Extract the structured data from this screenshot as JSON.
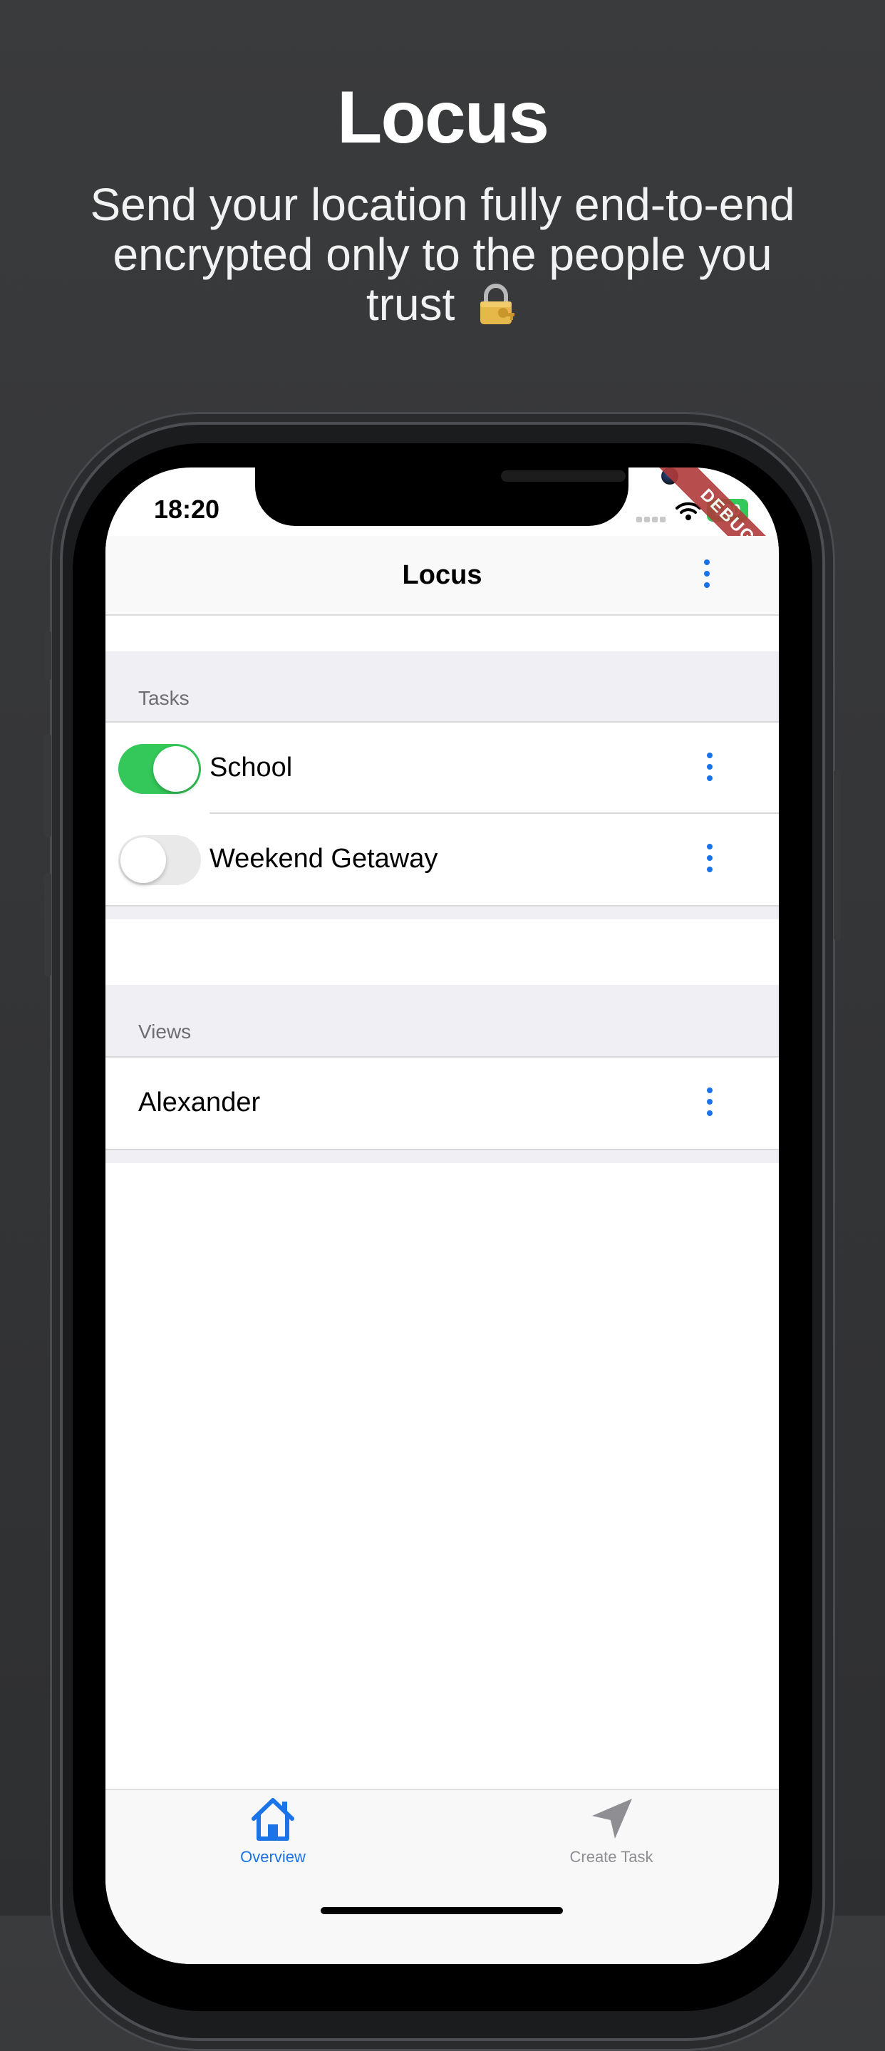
{
  "hero": {
    "title": "Locus",
    "subtitle": "Send your location fully end-to-end encrypted only to the people you trust",
    "emoji_icon": "lock-with-key-icon"
  },
  "status_bar": {
    "time": "18:20",
    "battery": "100",
    "debug_banner": "DEBUG"
  },
  "navbar": {
    "title": "Locus"
  },
  "tasks": {
    "header": "Tasks",
    "items": [
      {
        "label": "School",
        "enabled": true
      },
      {
        "label": "Weekend Getaway",
        "enabled": false
      }
    ]
  },
  "views": {
    "header": "Views",
    "items": [
      {
        "label": "Alexander"
      }
    ]
  },
  "tabbar": {
    "tabs": [
      {
        "label": "Overview",
        "icon": "home-icon",
        "active": true
      },
      {
        "label": "Create Task",
        "icon": "navigation-arrow-icon",
        "active": false
      }
    ]
  },
  "colors": {
    "accent": "#1a73e8",
    "toggle_on": "#34c759",
    "inactive_tab": "#8e8e93"
  }
}
